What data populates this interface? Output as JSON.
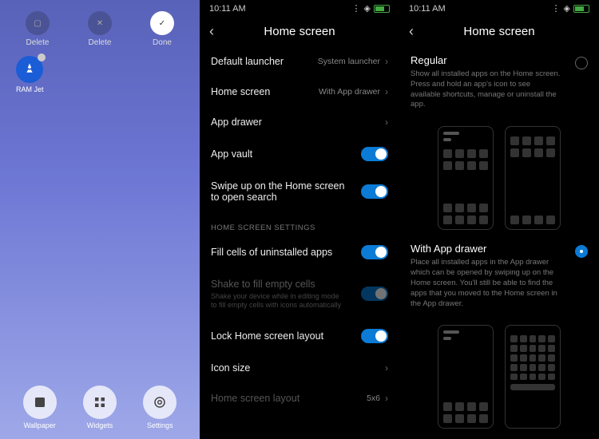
{
  "panel1": {
    "actions": [
      {
        "label": "Delete",
        "key": "delete"
      },
      {
        "label": "Delete",
        "key": "delete2"
      },
      {
        "label": "Done",
        "key": "done"
      }
    ],
    "app": {
      "name": "RAM Jet"
    },
    "dock": [
      {
        "label": "Wallpaper"
      },
      {
        "label": "Widgets"
      },
      {
        "label": "Settings"
      }
    ]
  },
  "panel2": {
    "time": "10:11 AM",
    "title": "Home screen",
    "items": [
      {
        "label": "Default launcher",
        "value": "System launcher",
        "type": "nav"
      },
      {
        "label": "Home screen",
        "value": "With App drawer",
        "type": "nav"
      },
      {
        "label": "App drawer",
        "value": "",
        "type": "nav"
      },
      {
        "label": "App vault",
        "type": "toggle",
        "on": true
      },
      {
        "label": "Swipe up on the Home screen to open search",
        "type": "toggle",
        "on": true
      }
    ],
    "section": "HOME SCREEN SETTINGS",
    "items2": [
      {
        "label": "Fill cells of uninstalled apps",
        "type": "toggle",
        "on": true
      },
      {
        "label": "Shake to fill empty cells",
        "sub": "Shake your device while in editing mode to fill empty cells with icons automatically",
        "type": "toggle",
        "on": true,
        "dim": true
      },
      {
        "label": "Lock Home screen layout",
        "type": "toggle",
        "on": true
      },
      {
        "label": "Icon size",
        "value": "",
        "type": "nav"
      },
      {
        "label": "Home screen layout",
        "value": "5x6",
        "type": "nav",
        "dim": true
      }
    ]
  },
  "panel3": {
    "time": "10:11 AM",
    "title": "Home screen",
    "options": [
      {
        "title": "Regular",
        "desc": "Show all installed apps on the Home screen. Press and hold an app's icon to see available shortcuts, manage or uninstall the app.",
        "selected": false
      },
      {
        "title": "With App drawer",
        "desc": "Place all installed apps in the App drawer which can be opened by swiping up on the Home screen. You'll still be able to find the apps that you moved to the Home screen in the App drawer.",
        "selected": true
      }
    ]
  }
}
